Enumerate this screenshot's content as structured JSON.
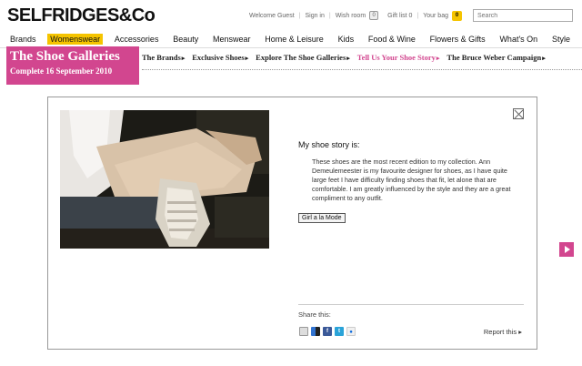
{
  "logo": {
    "text": "SELFRIDGES&Co"
  },
  "top": {
    "welcome": "Welcome Guest",
    "signin": "Sign in",
    "wishroom": "Wish room",
    "wish_count": "0",
    "giftlist": "Gift list 0",
    "yourbag": "Your bag",
    "bag_count": "0",
    "search_placeholder": "Search"
  },
  "nav": {
    "items": [
      "Brands",
      "Womenswear",
      "Accessories",
      "Beauty",
      "Menswear",
      "Home & Leisure",
      "Kids",
      "Food & Wine",
      "Flowers & Gifts",
      "What's On",
      "Style"
    ],
    "active": "Womenswear"
  },
  "banner": {
    "title": "The Shoe Galleries",
    "subtitle": "Complete 16 September 2010",
    "color": "#d2468f"
  },
  "subnav": {
    "items": [
      "The Brands",
      "Exclusive Shoes",
      "Explore The Shoe Galleries",
      "Tell Us Your Shoe Story",
      "The Bruce Weber Campaign"
    ],
    "active": "Tell Us Your Shoe Story"
  },
  "story": {
    "heading": "My shoe story is:",
    "body": "These shoes are the most recent edition to my collection. Ann Demeulemeester is my favourite designer for shoes, as I have quite large feet I have difficulty finding shoes that fit, let alone that are comfortable. I am greatly influenced by the style and they are a great compliment to any outfit.",
    "button": "Girl a la Mode"
  },
  "share": {
    "label": "Share this:",
    "icons": [
      "email-icon",
      "delicious-icon",
      "facebook-icon",
      "twitter-icon",
      "flickr-icon"
    ]
  },
  "report": {
    "label": "Report this"
  },
  "accent": "#f5c400"
}
